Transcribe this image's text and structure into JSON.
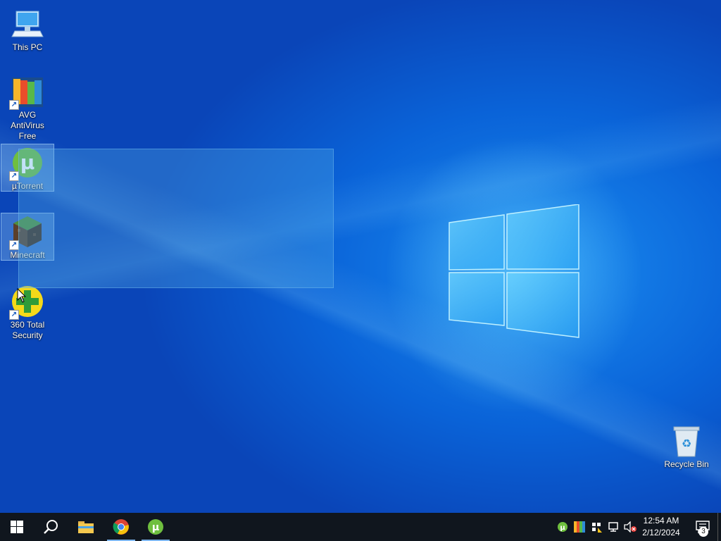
{
  "desktop": {
    "icons": [
      {
        "label": "This PC"
      },
      {
        "label": "AVG AntiVirus Free"
      },
      {
        "label": "µTorrent"
      },
      {
        "label": "Minecraft"
      },
      {
        "label": "360 Total Security"
      },
      {
        "label": "Recycle Bin"
      }
    ]
  },
  "taskbar": {
    "pinned": [
      {
        "icon": "start-windows-icon"
      },
      {
        "icon": "search-icon"
      },
      {
        "icon": "file-explorer-icon"
      },
      {
        "icon": "chrome-icon"
      },
      {
        "icon": "utorrent-icon"
      }
    ],
    "tray_icons": [
      "utorrent-tray-icon",
      "avg-tray-icon",
      "security-shield-icon",
      "network-icon",
      "volume-muted-icon"
    ],
    "clock": {
      "time": "12:54 AM",
      "date": "2/12/2024"
    },
    "notification_count": "3"
  },
  "colors": {
    "taskbar_bg": "#10161e",
    "wallpaper_blue": "#0a63d8",
    "selection": "#50aae6"
  }
}
